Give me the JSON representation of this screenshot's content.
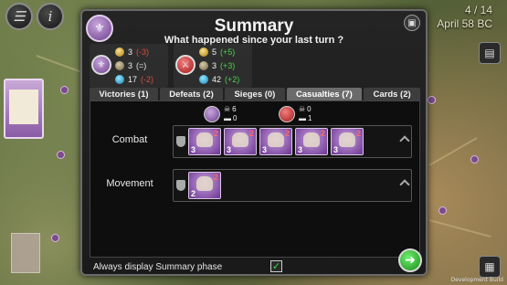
{
  "hud": {
    "turn": "4 / 14",
    "date": "April 58 BC",
    "menu_icon": "menu-icon",
    "info_icon": "info-icon"
  },
  "dialog": {
    "title": "Summary",
    "subtitle": "What happened since your last turn ?",
    "emblem_icon": "faction-emblem-icon",
    "close_icon": "close-icon"
  },
  "players": [
    {
      "color": "#8a55a8",
      "stats": [
        {
          "icon": "gold-wreath-icon",
          "value": "3",
          "delta": "(-3)",
          "tone": "neg"
        },
        {
          "icon": "stone-icon",
          "value": "3",
          "delta": "(=)",
          "tone": "neu"
        },
        {
          "icon": "blue-resource-icon",
          "value": "17",
          "delta": "(-2)",
          "tone": "neg"
        }
      ]
    },
    {
      "color": "#b52020",
      "stats": [
        {
          "icon": "gold-wreath-icon",
          "value": "5",
          "delta": "(+5)",
          "tone": "pos"
        },
        {
          "icon": "stone-icon",
          "value": "3",
          "delta": "(+3)",
          "tone": "pos"
        },
        {
          "icon": "blue-resource-icon",
          "value": "42",
          "delta": "(+2)",
          "tone": "pos"
        }
      ]
    }
  ],
  "tabs": [
    {
      "label": "Victories (1)",
      "active": false
    },
    {
      "label": "Defeats (2)",
      "active": false
    },
    {
      "label": "Sieges (0)",
      "active": false
    },
    {
      "label": "Casualties (7)",
      "active": true
    },
    {
      "label": "Cards (2)",
      "active": false
    }
  ],
  "casualties": {
    "player1": {
      "killed": "6",
      "lost": "0"
    },
    "player2": {
      "killed": "0",
      "lost": "1"
    },
    "rows": [
      {
        "label": "Combat",
        "units": [
          {
            "strength": "3",
            "damage": "2"
          },
          {
            "strength": "3",
            "damage": "2"
          },
          {
            "strength": "3",
            "damage": "2"
          },
          {
            "strength": "3",
            "damage": "2"
          },
          {
            "strength": "3",
            "damage": "2"
          }
        ]
      },
      {
        "label": "Movement",
        "units": [
          {
            "strength": "2",
            "damage": "2"
          }
        ]
      }
    ]
  },
  "footer": {
    "label": "Always display Summary phase",
    "checked": true,
    "check_mark": "✓"
  },
  "next_button": {
    "label": "➜"
  },
  "dev_label": "Development Build"
}
